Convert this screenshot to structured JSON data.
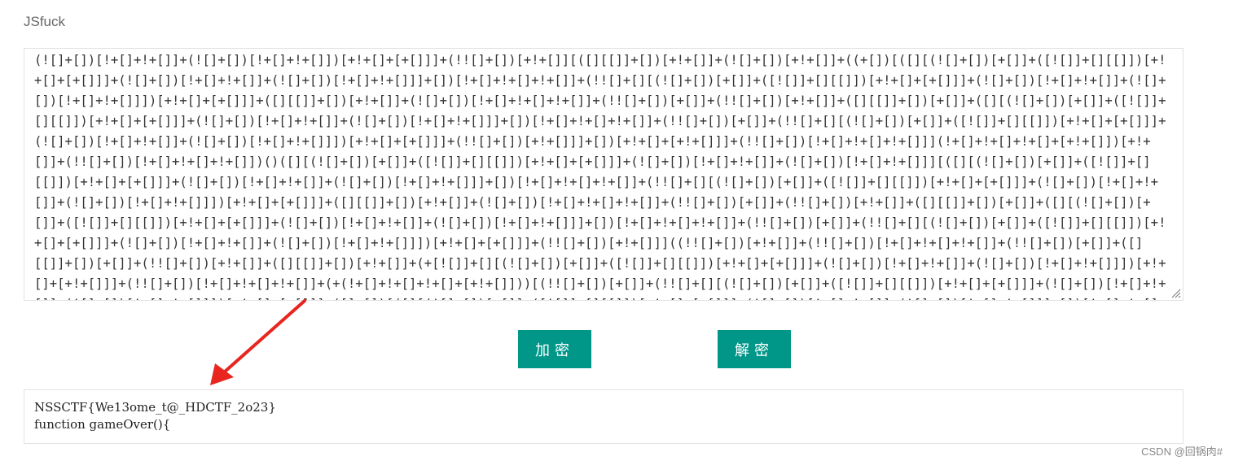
{
  "page": {
    "title": "JSfuck",
    "watermark": "CSDN @回锅肉#"
  },
  "input": {
    "code": "(![]+[])[!+[]+!+[]]+(![]+[])[!+[]+!+[]])[+!+[]+[+[]]]+(!![]+[])[+!+[]][([][[]]+[])[+!+[]]+(![]+[])[+!+[]]+((+[])[([][(![]+[])[+[]]+([![]]+[][[]])[+!+[]+[+[]]]+(![]+[])[!+[]+!+[]]+(![]+[])[!+[]+!+[]]]+[])[!+[]+!+[]+!+[]]+(!![]+[][(![]+[])[+[]]+([![]]+[][[]])[+!+[]+[+[]]]+(![]+[])[!+[]+!+[]]+(![]+[])[!+[]+!+[]]])[+!+[]+[+[]]]+([][[]]+[])[+!+[]]+(![]+[])[!+[]+!+[]+!+[]]+(!![]+[])[+[]]+(!![]+[])[+!+[]]+([][[]]+[])[+[]]+([][(![]+[])[+[]]+([![]]+[][[]])[+!+[]+[+[]]]+(![]+[])[!+[]+!+[]]+(![]+[])[!+[]+!+[]]]+[])[!+[]+!+[]+!+[]]+(!![]+[])[+[]]+(!![]+[][(![]+[])[+[]]+([![]]+[][[]])[+!+[]+[+[]]]+(![]+[])[!+[]+!+[]]+(![]+[])[!+[]+!+[]]])[+!+[]+[+[]]]+(!![]+[])[+!+[]]]+[])[+!+[]+[+!+[]]]+(!![]+[])[!+[]+!+[]+!+[]]](!+[]+!+[]+!+[]+[+!+[]])[+!+[]]+(!![]+[])[!+[]+!+[]+!+[]])()([][(![]+[])[+[]]+([![]]+[][[]])[+!+[]+[+[]]]+(![]+[])[!+[]+!+[]]+(![]+[])[!+[]+!+[]]][([][(![]+[])[+[]]+([![]]+[][[]])[+!+[]+[+[]]]+(![]+[])[!+[]+!+[]]+(![]+[])[!+[]+!+[]]]+[])[!+[]+!+[]+!+[]]+(!![]+[][(![]+[])[+[]]+([![]]+[][[]])[+!+[]+[+[]]]+(![]+[])[!+[]+!+[]]+(![]+[])[!+[]+!+[]]])[+!+[]+[+[]]]+([][[]]+[])[+!+[]]+(![]+[])[!+[]+!+[]+!+[]]+(!![]+[])[+[]]+(!![]+[])[+!+[]]+([][[]]+[])[+[]]+([][(![]+[])[+[]]+([![]]+[][[]])[+!+[]+[+[]]]+(![]+[])[!+[]+!+[]]+(![]+[])[!+[]+!+[]]]+[])[!+[]+!+[]+!+[]]+(!![]+[])[+[]]+(!![]+[][(![]+[])[+[]]+([![]]+[][[]])[+!+[]+[+[]]]+(![]+[])[!+[]+!+[]]+(![]+[])[!+[]+!+[]]])[+!+[]+[+[]]]+(!![]+[])[+!+[]]]((!![]+[])[+!+[]]+(!![]+[])[!+[]+!+[]+!+[]]+(!![]+[])[+[]]+([][[]]+[])[+[]]+(!![]+[])[+!+[]]+([][[]]+[])[+!+[]]+(+[![]]+[][(![]+[])[+[]]+([![]]+[][[]])[+!+[]+[+[]]]+(![]+[])[!+[]+!+[]]+(![]+[])[!+[]+!+[]]])[+!+[]+[+!+[]]]+(!![]+[])[!+[]+!+[]+!+[]]+(+(!+[]+!+[]+!+[]+[+!+[]]))[(!![]+[])[+[]]+(!![]+[][(![]+[])[+[]]+([![]]+[][[]])[+!+[]+[+[]]]+(![]+[])[!+[]+!+[]]+(![]+[])[!+[]+!+[]]])[+!+[]+[+[]]]+([]+[])[([][(![]+[])[+[]]+([![]]+[][[]])[+!+[]+[+[]]]+(![]+[])[!+[]+!+[]]+(![]+[])[!+[]+!+[]]]+[])[!+[]+!+[]+!+[]]+(!![]+[][(![]+[])[+[]]+([![]]+[][[]])[+!+[]+[+[]]]+(![]+[])[!+[]+!+[]]+(![]+[])[!+[]+!+[]]])[+!+[]+[+[]]]+([][[]]+[])[+!+[]]+(![]+[])[!+[]+!+[]+!+[]]+(!![]+[])[+[]]+(!![]+[])[+!+[]]+([][[]]+[])[+[]]+([][(![]+[])[+[]]+([![]]+[][[]])[+!+[]+[+[]]]+(![]+[])[!+[]+!+[]]+(![]+[])[!+[]+!+[]]]+[])[!+[]+!+[]+!+[]]+(!![]+[])[+[]]"
  },
  "buttons": {
    "encrypt": "加密",
    "decrypt": "解密"
  },
  "output": {
    "line1": "NSSCTF{We13ome_t@_HDCTF_2o23}",
    "line2": "function gameOver(){"
  },
  "colors": {
    "button_bg": "#009688",
    "arrow": "#e8251f"
  }
}
